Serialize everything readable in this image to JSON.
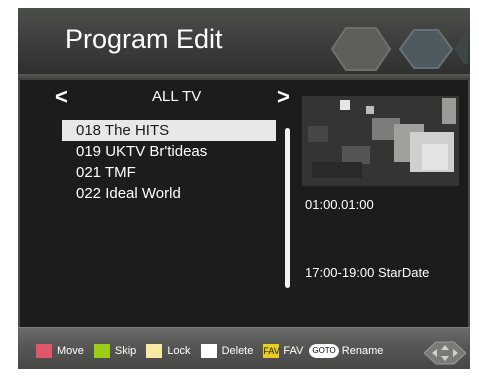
{
  "header": {
    "title": "Program Edit"
  },
  "group": {
    "prev_arrow": "<",
    "label": "ALL TV",
    "next_arrow": ">"
  },
  "channels": [
    {
      "label": "018 The HITS",
      "selected": true
    },
    {
      "label": "019 UKTV Br'tideas",
      "selected": false
    },
    {
      "label": "021 TMF",
      "selected": false
    },
    {
      "label": "022 Ideal World",
      "selected": false
    }
  ],
  "info": {
    "time_code": "01:00.01:00",
    "schedule": "17:00-19:00  StarDate"
  },
  "legend": {
    "move": {
      "label": "Move",
      "color": "#e0566c"
    },
    "skip": {
      "label": "Skip",
      "color": "#9ccc17"
    },
    "lock": {
      "label": "Lock",
      "color": "#f6eaa0"
    },
    "delete": {
      "label": "Delete",
      "color": "#ffffff"
    },
    "fav": {
      "key": "FAV",
      "label": "FAV"
    },
    "rename": {
      "key": "GOTO",
      "label": "Rename"
    }
  }
}
